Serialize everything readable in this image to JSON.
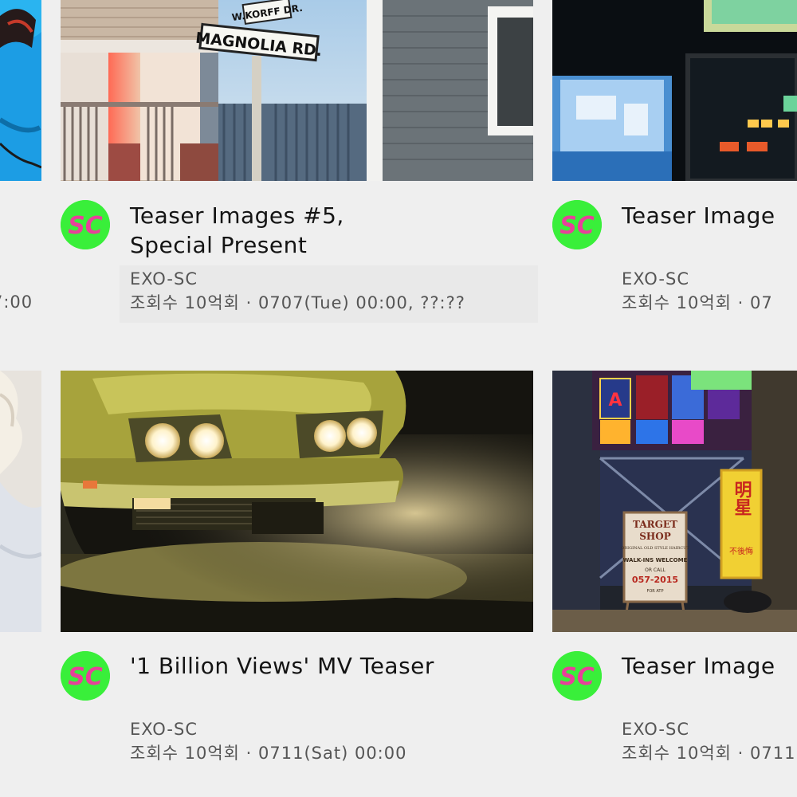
{
  "videos": [
    {
      "title_line1": "",
      "title_line2": "",
      "channel": "",
      "stats": "7:00"
    },
    {
      "title_line1": "Teaser Images #5,",
      "title_line2": "Special Present",
      "channel": "EXO-SC",
      "stats": "조회수 10억회 · 0707(Tue) 00:00, ??:??"
    },
    {
      "title_line1": "Teaser Image",
      "title_line2": "",
      "channel": "EXO-SC",
      "stats": "조회수 10억회 · 07"
    },
    {
      "title_line1": "'1 Billion Views' MV Teaser",
      "title_line2": "",
      "channel": "EXO-SC",
      "stats": "조회수 10억회 · 0711(Sat) 00:00"
    },
    {
      "title_line1": "Teaser Image",
      "title_line2": "",
      "channel": "EXO-SC",
      "stats": "조회수 10억회 · 0711"
    }
  ],
  "channel_avatar": {
    "label": "SC",
    "icon": "exo-sc-logo-icon",
    "background_color": "#39ef3a",
    "text_color": "#e8409a"
  },
  "thumbnails": {
    "magnolia_sign_top": "W.KORFF DR.",
    "magnolia_sign_bottom": "MAGNOLIA RD.",
    "target_shop_line1": "TARGET",
    "target_shop_line2": "SHOP",
    "target_shop_line3": "ORIGINAL OLD STYLE HAIRCUT",
    "target_shop_line4": "WALK-INS WELCOME",
    "target_shop_line5": "OR CALL",
    "target_shop_line6": "057-2015",
    "target_shop_line7": "FOR ATP",
    "neon_sign_chars": "明星",
    "neon_sign_small": "不後悔"
  }
}
